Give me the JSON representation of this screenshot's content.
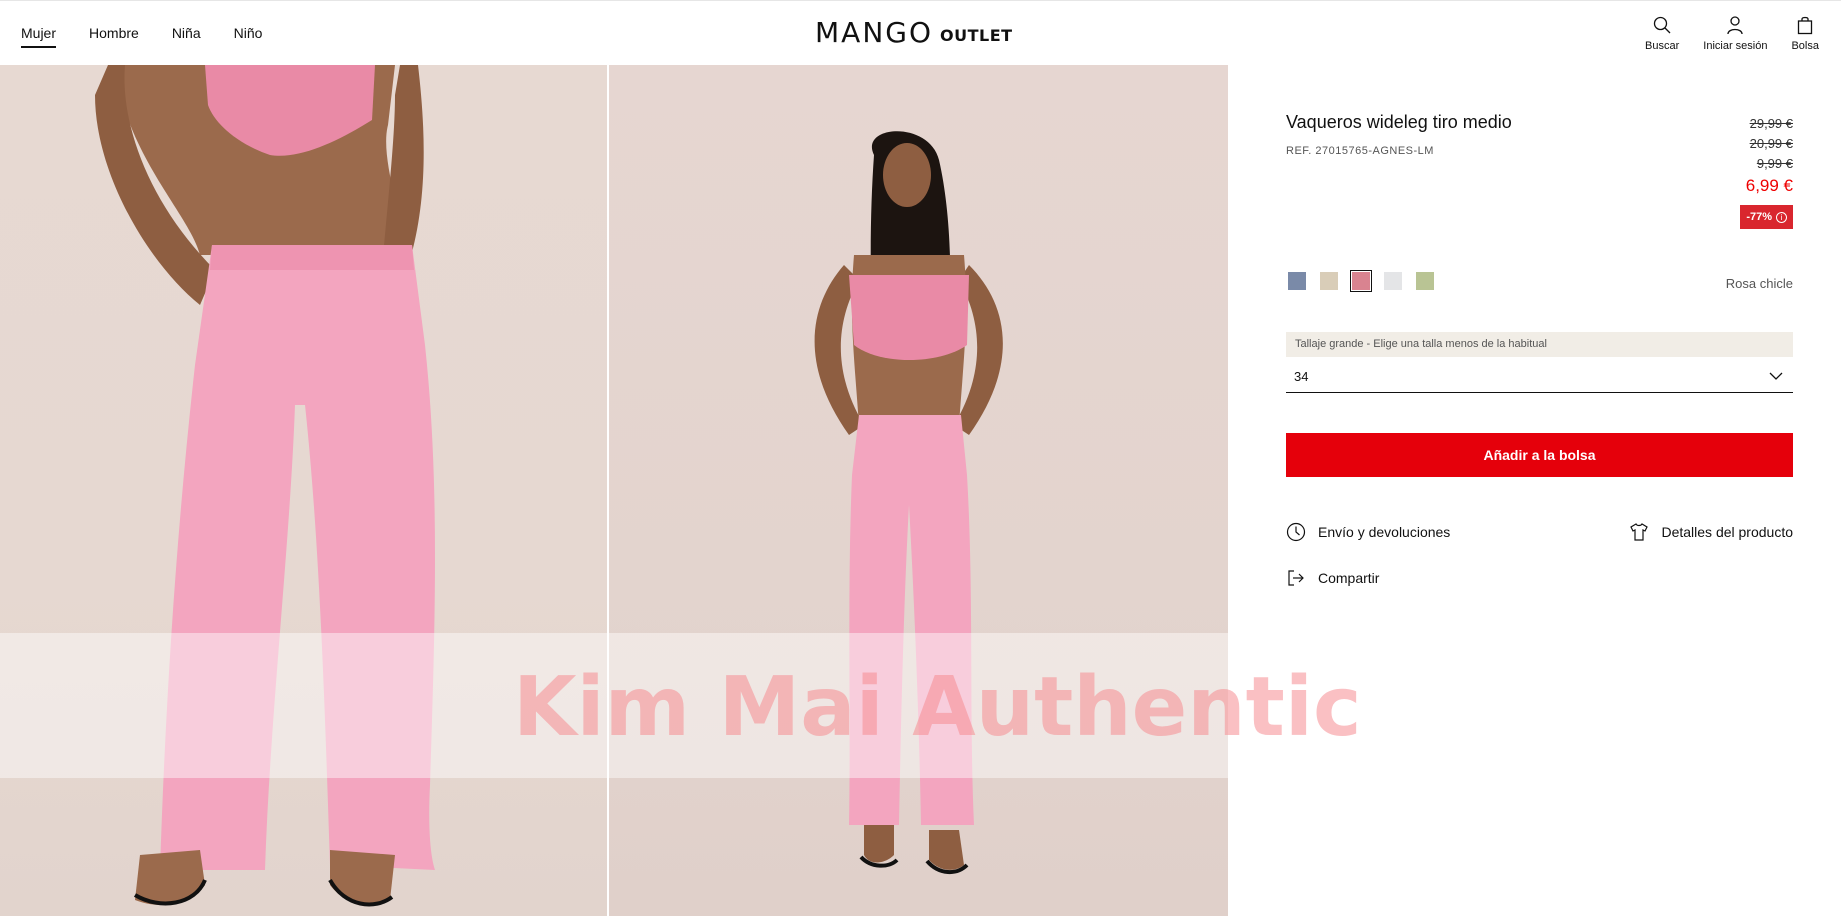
{
  "nav": {
    "items": [
      {
        "label": "Mujer",
        "active": true
      },
      {
        "label": "Hombre",
        "active": false
      },
      {
        "label": "Niña",
        "active": false
      },
      {
        "label": "Niño",
        "active": false
      }
    ]
  },
  "logo": {
    "brand": "MANGO",
    "sub": "OUTLET"
  },
  "header_actions": {
    "search": "Buscar",
    "login": "Iniciar sesión",
    "bag": "Bolsa"
  },
  "product": {
    "title": "Vaqueros wideleg tiro medio",
    "ref": "REF. 27015765-AGNES-LM",
    "prices": {
      "old": [
        "29,99 €",
        "20,99 €",
        "9,99 €"
      ],
      "current": "6,99 €"
    },
    "discount": "-77%",
    "colors": {
      "swatches": [
        "#7a8aa8",
        "#d9cdb8",
        "#d98390",
        "#e4e5e7",
        "#b9c494"
      ],
      "selected_index": 2,
      "selected_name": "Rosa chicle"
    },
    "size_hint": "Tallaje grande - Elige una talla menos de la habitual",
    "size_selected": "34",
    "add_to_bag": "Añadir a la bolsa",
    "links": {
      "shipping": "Envío y devoluciones",
      "details": "Detalles del producto",
      "share": "Compartir"
    }
  },
  "watermark": "Kim Mai Authentic",
  "accent_color": "#e5000b"
}
